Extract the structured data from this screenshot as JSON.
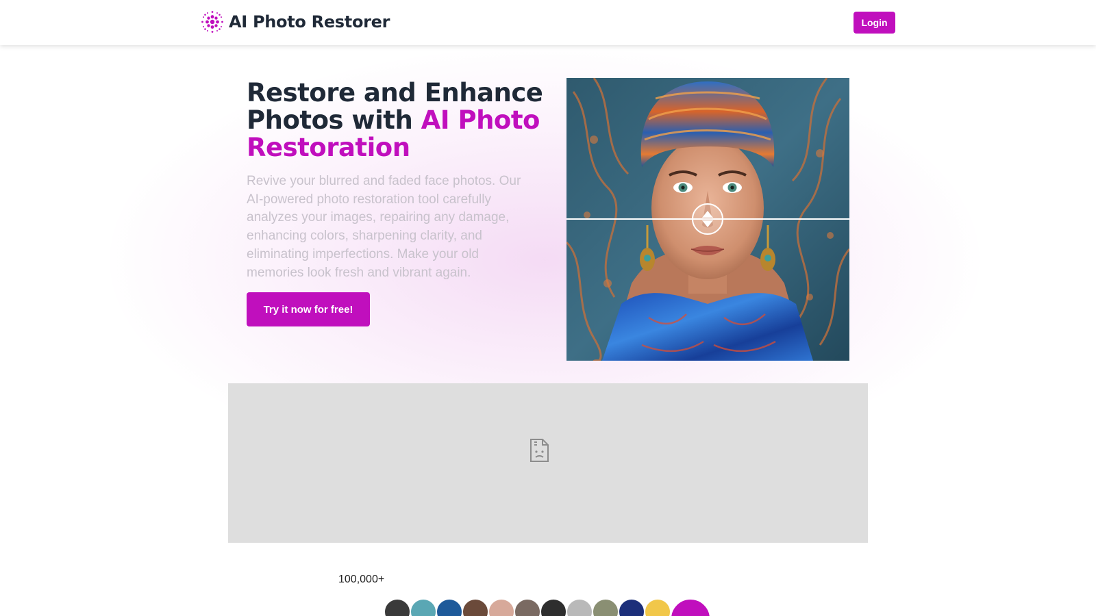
{
  "header": {
    "brand": "AI Photo Restorer",
    "login_label": "Login",
    "logo_icon": "dotted-sphere-icon"
  },
  "hero": {
    "title_part1": "Restore and Enhance Photos with ",
    "title_accent": "AI Photo Restoration",
    "description": "Revive your blurred and faded face photos. Our AI-powered photo restoration tool carefully analyzes your images, repairing any damage, enhancing colors, sharpening clarity, and eliminating imperfections. Make your old memories look fresh and vibrant again.",
    "cta_label": "Try it now for free!",
    "compare_icon": "up-down-arrows-icon"
  },
  "video": {
    "icon": "broken-file-icon"
  },
  "social_proof": {
    "count": "100,000+"
  },
  "colors": {
    "accent": "#c00fbd",
    "title": "#1f2937",
    "description": "#c8c2cc",
    "video_placeholder": "#dedede"
  }
}
